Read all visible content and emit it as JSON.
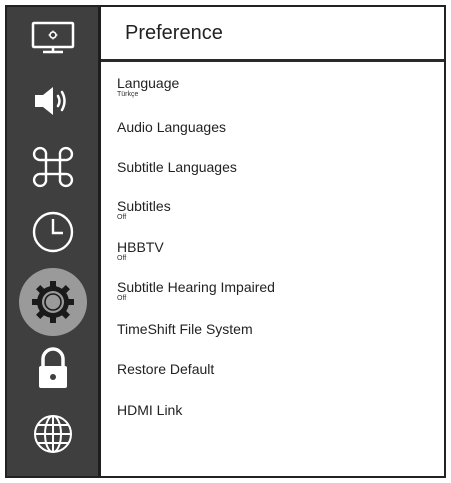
{
  "header": {
    "title": "Preference"
  },
  "sidebar": {
    "items": [
      {
        "icon": "display-icon"
      },
      {
        "icon": "speaker-icon"
      },
      {
        "icon": "command-icon"
      },
      {
        "icon": "clock-icon"
      },
      {
        "icon": "gear-icon",
        "active": true
      },
      {
        "icon": "lock-icon"
      },
      {
        "icon": "globe-icon"
      }
    ]
  },
  "menu": {
    "items": [
      {
        "label": "Language",
        "value": "Türkçe"
      },
      {
        "label": "Audio Languages"
      },
      {
        "label": "Subtitle Languages"
      },
      {
        "label": "Subtitles",
        "value": "Off"
      },
      {
        "label": "HBBTV",
        "value": "Off"
      },
      {
        "label": "Subtitle Hearing Impaired",
        "value": "Off"
      },
      {
        "label": "TimeShift File System"
      },
      {
        "label": "Restore Default"
      },
      {
        "label": "HDMI Link"
      }
    ]
  },
  "colors": {
    "sidebar_bg": "#3f3f3f",
    "active_disc": "#9a9a9a",
    "icon": "#ffffff",
    "text": "#222222"
  }
}
